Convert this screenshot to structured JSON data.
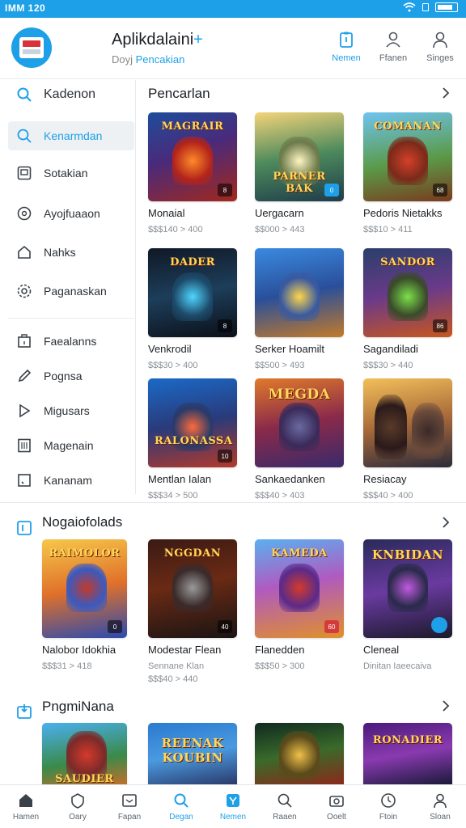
{
  "status_bar": {
    "time": "IMM 120"
  },
  "header": {
    "title": "Aplikdalaini",
    "title_plus": "+",
    "subtitle_prefix": "Doyj",
    "subtitle_accent": "Pencakian",
    "actions": [
      {
        "label": "Nemen",
        "icon": "clipboard-icon"
      },
      {
        "label": "Ffanen",
        "icon": "user-outline-icon"
      },
      {
        "label": "Singes",
        "icon": "person-icon"
      }
    ]
  },
  "sidebar": {
    "search_label": "Kadenon",
    "items": [
      {
        "label": "Kenarmdan",
        "icon": "search-icon"
      },
      {
        "label": "Sotakian",
        "icon": "tablet-icon"
      },
      {
        "label": "Ayojfuaaon",
        "icon": "compass-icon"
      },
      {
        "label": "Nahks",
        "icon": "home-icon"
      },
      {
        "label": "Paganaskan",
        "icon": "gear-icon"
      },
      {
        "label": "Faealanns",
        "icon": "building-icon"
      },
      {
        "label": "Pognsa",
        "icon": "pencil-icon"
      },
      {
        "label": "Migusars",
        "icon": "play-icon"
      },
      {
        "label": "Magenain",
        "icon": "calculator-icon"
      },
      {
        "label": "Kananam",
        "icon": "check-square-icon"
      }
    ]
  },
  "top_section": {
    "title": "Pencarlan",
    "cards": [
      {
        "name": "Monaial",
        "meta": "$$$140 > 400",
        "art": "MAGRAIR",
        "badge": "8"
      },
      {
        "name": "Uergacarn",
        "meta": "$$000 > 443",
        "art": "PARNER BAK",
        "badge": "0"
      },
      {
        "name": "Pedoris Nietakks",
        "meta": "$$$10 > 411",
        "art": "COMANAN",
        "badge": "68"
      },
      {
        "name": "Venkrodil",
        "meta": "$$$30 > 400",
        "art": "DADER",
        "badge": "8"
      },
      {
        "name": "Serker Hoamilt",
        "meta": "$$500 > 493",
        "art": "",
        "badge": ""
      },
      {
        "name": "Sagandiladi",
        "meta": "$$$30 > 440",
        "art": "SANDOR",
        "badge": "86"
      },
      {
        "name": "Mentlan Ialan",
        "meta": "$$$34 > 500",
        "art": "RALONASSA",
        "badge": "10"
      },
      {
        "name": "Sankaedanken",
        "meta": "$$$40 > 403",
        "art": "MEGDA",
        "badge": ""
      },
      {
        "name": "Resiacay",
        "meta": "$$$40 > 400",
        "art": "",
        "badge": ""
      }
    ]
  },
  "section2": {
    "title": "Nogaiofolads",
    "cards": [
      {
        "name": "Nalobor Idokhia",
        "meta": "$$$31 > 418",
        "meta2": "",
        "art": "RAIMOLOR",
        "badge": "0"
      },
      {
        "name": "Modestar Flean",
        "meta": "Sennane Klan",
        "meta2": "$$$40 > 440",
        "art": "NGGDAN",
        "badge": "40"
      },
      {
        "name": "Flanedden",
        "meta": "$$$50 > 300",
        "meta2": "",
        "art": "KAMEDA",
        "badge": "60"
      },
      {
        "name": "Cleneal",
        "meta": "Dinitan Iaeecaiva",
        "meta2": "",
        "art": "KNBIDAN",
        "badge": ""
      }
    ]
  },
  "section3": {
    "title": "PngmiNana",
    "cards": [
      {
        "art": "SAUDIER"
      },
      {
        "art": "REENAK KOUBIN"
      },
      {
        "art": ""
      },
      {
        "art": "RONADIER"
      }
    ]
  },
  "bottom_nav": [
    {
      "label": "Hamen",
      "icon": "home-icon"
    },
    {
      "label": "Oary",
      "icon": "shield-icon"
    },
    {
      "label": "Fapan",
      "icon": "card-icon"
    },
    {
      "label": "Degan",
      "icon": "search-icon"
    },
    {
      "label": "Nemen",
      "icon": "badge-icon"
    },
    {
      "label": "Raaen",
      "icon": "search-icon"
    },
    {
      "label": "Ooelt",
      "icon": "camera-icon"
    },
    {
      "label": "Ftoin",
      "icon": "clock-icon"
    },
    {
      "label": "Sloan",
      "icon": "person-icon"
    }
  ],
  "colors": {
    "accent": "#1ea0e8",
    "status_bar": "#1ea0e8",
    "divider": "#e6e9ee"
  }
}
